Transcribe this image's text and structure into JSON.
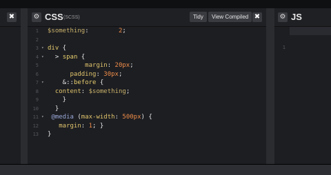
{
  "css_panel": {
    "title": "CSS",
    "subtitle": "(SCSS)",
    "tidy_label": "Tidy",
    "view_compiled_label": "View Compiled",
    "settings_icon": "gear-icon",
    "close_icon": "close-icon",
    "close_symbol": "✖",
    "settings_symbol": "⚙"
  },
  "js_panel": {
    "title": "JS",
    "settings_symbol": "⚙",
    "line_number": "1"
  },
  "left_panel": {
    "close_symbol": "✖"
  },
  "code_lines": [
    {
      "n": "1",
      "fold": "",
      "segments": [
        [
          "var",
          "$something"
        ],
        [
          "punc",
          ":        "
        ],
        [
          "num",
          "2"
        ],
        [
          "punc",
          ";"
        ]
      ]
    },
    {
      "n": "2",
      "fold": "",
      "segments": []
    },
    {
      "n": "3",
      "fold": "▾",
      "segments": [
        [
          "sel",
          "div"
        ],
        [
          "punc",
          " {"
        ]
      ]
    },
    {
      "n": "4",
      "fold": "▾",
      "segments": [
        [
          "punc",
          "  > "
        ],
        [
          "sel",
          "span"
        ],
        [
          "punc",
          " {"
        ]
      ]
    },
    {
      "n": "5",
      "fold": "",
      "segments": [
        [
          "prop",
          "          margin"
        ],
        [
          "punc",
          ": "
        ],
        [
          "num",
          "20px"
        ],
        [
          "punc",
          ";"
        ]
      ]
    },
    {
      "n": "6",
      "fold": "",
      "segments": [
        [
          "prop",
          "      padding"
        ],
        [
          "punc",
          ": "
        ],
        [
          "num",
          "30px"
        ],
        [
          "punc",
          ";"
        ]
      ]
    },
    {
      "n": "7",
      "fold": "▾",
      "segments": [
        [
          "punc",
          "    &::"
        ],
        [
          "sel",
          "before"
        ],
        [
          "punc",
          " {"
        ]
      ]
    },
    {
      "n": "8",
      "fold": "",
      "segments": [
        [
          "prop",
          "  content"
        ],
        [
          "punc",
          ": "
        ],
        [
          "var",
          "$something"
        ],
        [
          "punc",
          ";"
        ]
      ]
    },
    {
      "n": "9",
      "fold": "",
      "segments": [
        [
          "punc",
          "    }"
        ]
      ]
    },
    {
      "n": "10",
      "fold": "",
      "segments": [
        [
          "punc",
          "  }"
        ]
      ]
    },
    {
      "n": "11",
      "fold": "▾",
      "segments": [
        [
          "at",
          " @media"
        ],
        [
          "punc",
          " ("
        ],
        [
          "prop",
          "max-width"
        ],
        [
          "punc",
          ": "
        ],
        [
          "num",
          "500px"
        ],
        [
          "punc",
          ") {"
        ]
      ]
    },
    {
      "n": "12",
      "fold": "",
      "segments": [
        [
          "prop",
          "   margin"
        ],
        [
          "punc",
          ": "
        ],
        [
          "num",
          "1"
        ],
        [
          "punc",
          "; }"
        ]
      ]
    },
    {
      "n": "13",
      "fold": "",
      "segments": [
        [
          "punc",
          "}"
        ]
      ]
    }
  ]
}
